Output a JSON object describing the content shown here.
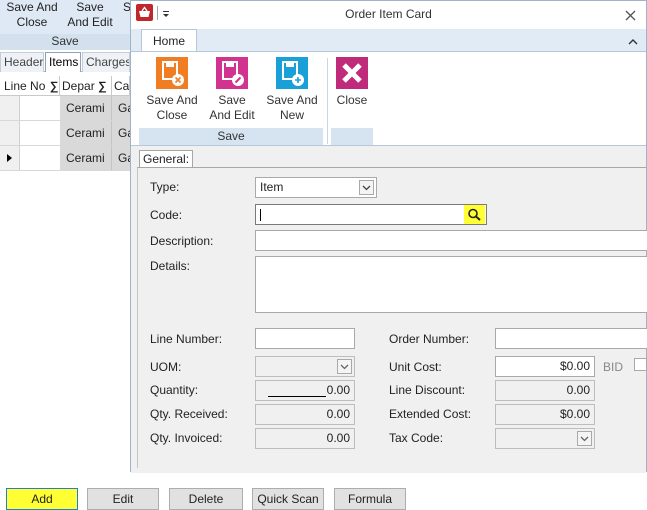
{
  "background": {
    "ribbon": {
      "save_and_close": "Save And\nClose",
      "save_and_edit": "Save\nAnd Edit",
      "s_partial": "S",
      "group_label": "Save"
    },
    "tabs": [
      "Header",
      "Items",
      "Charges"
    ],
    "grid": {
      "headers": [
        "Line No",
        "Depar",
        "Ca"
      ],
      "rows": [
        {
          "col1": "Cerami",
          "col2": "Ga",
          "current": false
        },
        {
          "col1": "Cerami",
          "col2": "Ga",
          "current": false
        },
        {
          "col1": "Cerami",
          "col2": "Ga",
          "current": true
        }
      ]
    },
    "bottom_buttons": [
      "Add",
      "Edit",
      "Delete",
      "Quick Scan",
      "Formula"
    ]
  },
  "dialog": {
    "title": "Order Item Card",
    "ribbon_tab": "Home",
    "buttons": {
      "save_and_close": "Save And\nClose",
      "save_and_edit": "Save\nAnd Edit",
      "save_and_new": "Save And\nNew",
      "close": "Close"
    },
    "save_group_label": "Save",
    "general_tab": "General:",
    "form": {
      "type_label": "Type:",
      "type_value": "Item",
      "code_label": "Code:",
      "code_value": "",
      "description_label": "Description:",
      "details_label": "Details:",
      "line_number_label": "Line Number:",
      "order_number_label": "Order Number:",
      "uom_label": "UOM:",
      "unit_cost_label": "Unit Cost:",
      "unit_cost_value": "$0.00",
      "bid_label": "BID",
      "quantity_label": "Quantity:",
      "quantity_value": "0.00",
      "line_discount_label": "Line Discount:",
      "line_discount_value": "0.00",
      "qty_received_label": "Qty. Received:",
      "qty_received_value": "0.00",
      "extended_cost_label": "Extended Cost:",
      "extended_cost_value": "$0.00",
      "qty_invoiced_label": "Qty. Invoiced:",
      "qty_invoiced_value": "0.00",
      "tax_code_label": "Tax Code:"
    }
  },
  "colors": {
    "highlight": "#ffff33",
    "save_icon": "#f07d22",
    "save_edit_icon": "#d1338f",
    "save_new_icon": "#1aa0d8",
    "close_icon": "#c02a7b"
  }
}
